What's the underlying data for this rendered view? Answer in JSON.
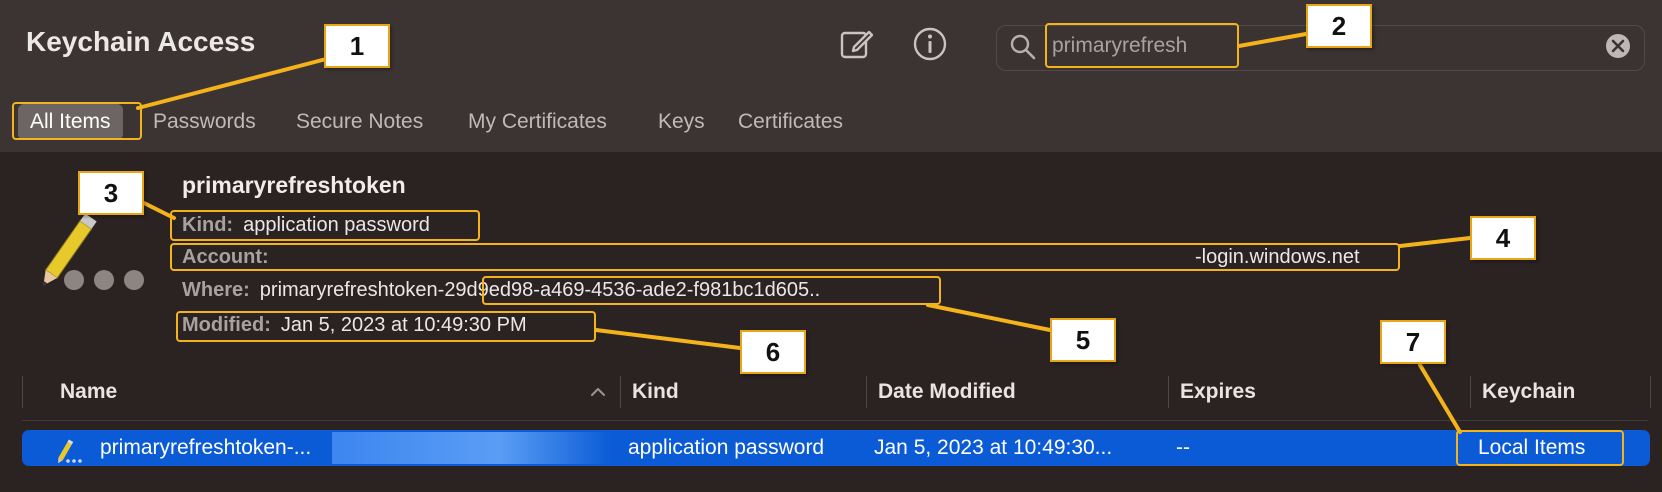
{
  "window": {
    "title": "Keychain Access"
  },
  "toolbar": {
    "compose_icon": "compose-icon",
    "info_icon": "info-icon"
  },
  "search": {
    "value": "primaryrefresh",
    "icon": "magnifying-glass-icon",
    "clear_icon": "clear-icon"
  },
  "tabs": [
    "All Items",
    "Passwords",
    "Secure Notes",
    "My Certificates",
    "Keys",
    "Certificates"
  ],
  "active_tab": "All Items",
  "detail": {
    "name": "primaryrefreshtoken",
    "kind_label": "Kind:",
    "kind_value": "application password",
    "account_label": "Account:",
    "account_value_end": "-login.windows.net",
    "where_label": "Where:",
    "where_value_prefix": "primaryrefreshtoken-",
    "where_value_id": "29d9ed98-a469-4536-ade2-f981bc1d605",
    "where_value_suffix": "..",
    "modified_label": "Modified:",
    "modified_value": "Jan 5, 2023 at 10:49:30 PM"
  },
  "table": {
    "columns": [
      "Name",
      "Kind",
      "Date Modified",
      "Expires",
      "Keychain"
    ],
    "rows": [
      {
        "name": "primaryrefreshtoken-...",
        "kind": "application password",
        "date_modified": "Jan 5, 2023 at 10:49:30...",
        "expires": "--",
        "keychain": "Local Items"
      }
    ]
  },
  "annotations": [
    "1",
    "2",
    "3",
    "4",
    "5",
    "6",
    "7"
  ],
  "colors": {
    "highlight": "#f5b31b",
    "selection": "#0a5bd5",
    "toolbar_bg": "#3b3432",
    "body_bg": "#2b2322"
  }
}
